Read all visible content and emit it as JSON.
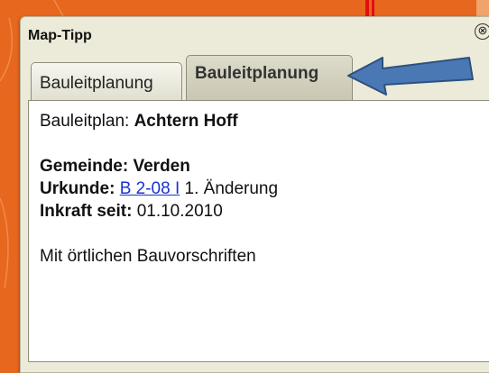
{
  "popup": {
    "title": "Map-Tipp",
    "close_symbol": "⊗",
    "tabs": [
      {
        "label": "Bauleitplanung",
        "active": false
      },
      {
        "label": "Bauleitplanung",
        "active": true
      }
    ]
  },
  "details": {
    "plan_label": "Bauleitplan:",
    "plan_name": "Achtern Hoff",
    "municipality_label": "Gemeinde:",
    "municipality": "Verden",
    "document_label": "Urkunde:",
    "document_link": "B 2-08 I",
    "document_suffix": "1. Änderung",
    "effective_label": "Inkraft seit:",
    "effective_date": "01.10.2010",
    "note": "Mit örtlichen Bauvorschriften"
  },
  "colors": {
    "map_orange": "#e8671e",
    "arrow_blue": "#4a78b5",
    "link_blue": "#1a33cc"
  }
}
